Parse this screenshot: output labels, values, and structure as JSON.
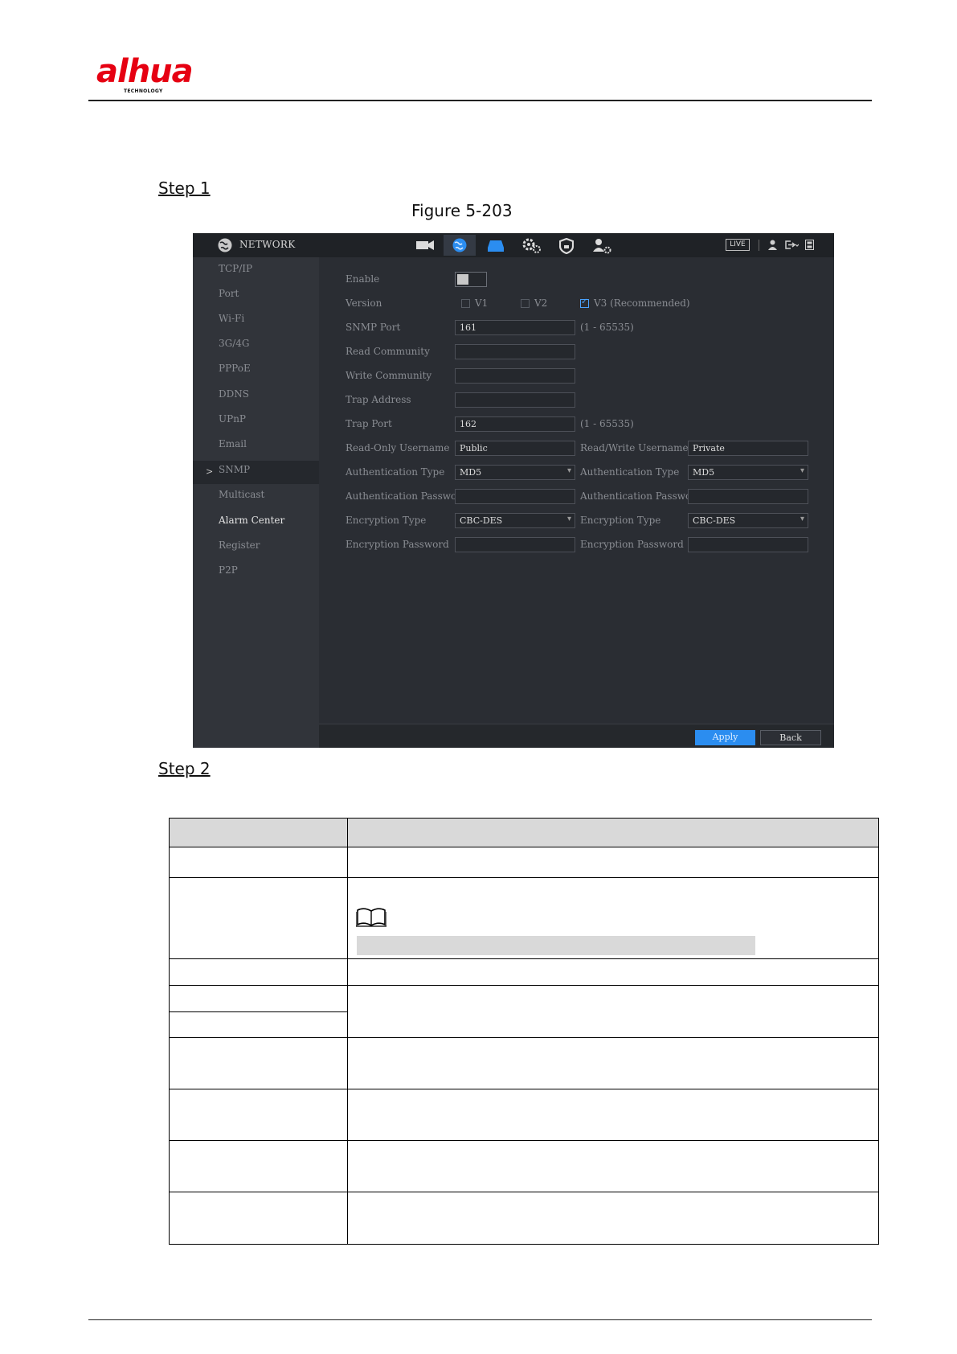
{
  "header": {
    "logo_text": "alhua",
    "logo_sub": "TECHNOLOGY"
  },
  "steps": {
    "step1": "Step 1",
    "step2": "Step 2"
  },
  "figure": {
    "caption": "Figure 5-203"
  },
  "device_ui": {
    "title": "NETWORK",
    "top_icons": [
      "camera-icon",
      "network-globe-icon",
      "storage-icon",
      "system-gear-icon",
      "security-shield-icon",
      "account-icon"
    ],
    "live_label": "LIVE",
    "right_icons": [
      "user-icon",
      "logout-icon",
      "grid-icon"
    ],
    "sidebar": {
      "items": [
        {
          "label": "TCP/IP"
        },
        {
          "label": "Port"
        },
        {
          "label": "Wi-Fi"
        },
        {
          "label": "3G/4G"
        },
        {
          "label": "PPPoE"
        },
        {
          "label": "DDNS"
        },
        {
          "label": "UPnP"
        },
        {
          "label": "Email"
        },
        {
          "label": "SNMP",
          "active": true
        },
        {
          "label": "Multicast"
        },
        {
          "label": "Alarm Center"
        },
        {
          "label": "Register"
        },
        {
          "label": "P2P"
        }
      ],
      "active_arrow": ">"
    },
    "form": {
      "enable_label": "Enable",
      "enable_on": false,
      "version_label": "Version",
      "v1_label": "V1",
      "v1_checked": false,
      "v2_label": "V2",
      "v2_checked": false,
      "v3_label": "V3 (Recommended)",
      "v3_checked": true,
      "snmp_port_label": "SNMP Port",
      "snmp_port_value": "161",
      "snmp_port_range": "(1 - 65535)",
      "read_community_label": "Read Community",
      "read_community_value": "",
      "write_community_label": "Write Community",
      "write_community_value": "",
      "trap_address_label": "Trap Address",
      "trap_address_value": "",
      "trap_port_label": "Trap Port",
      "trap_port_value": "162",
      "trap_port_range": "(1 - 65535)",
      "ro_username_label": "Read-Only Username",
      "ro_username_value": "Public",
      "rw_username_label": "Read/Write Username",
      "rw_username_value": "Private",
      "auth_type_label": "Authentication Type",
      "auth_type_value": "MD5",
      "rw_auth_type_label": "Authentication Type",
      "rw_auth_type_value": "MD5",
      "auth_password_label": "Authentication Password",
      "auth_password_value": "",
      "rw_auth_password_label": "Authentication Password",
      "rw_auth_password_value": "",
      "enc_type_label": "Encryption Type",
      "enc_type_value": "CBC-DES",
      "rw_enc_type_label": "Encryption Type",
      "rw_enc_type_value": "CBC-DES",
      "enc_password_label": "Encryption Password",
      "enc_password_value": "",
      "rw_enc_password_label": "Encryption Password",
      "rw_enc_password_value": ""
    },
    "buttons": {
      "apply": "Apply",
      "back": "Back"
    }
  },
  "colors": {
    "brand_red": "#e60012",
    "ui_background": "#2a2d33",
    "apply_blue": "#2b8df0",
    "table_header_gray": "#d9d9d9"
  },
  "note_icon": "book-note-icon"
}
